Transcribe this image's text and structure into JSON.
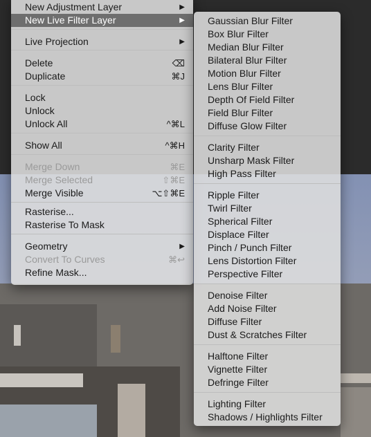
{
  "main_menu": {
    "items": [
      {
        "label": "New Adjustment Layer",
        "shortcut": "",
        "has_submenu": true
      },
      {
        "label": "New Live Filter Layer",
        "shortcut": "",
        "has_submenu": true
      },
      {
        "label": "Live Projection",
        "shortcut": "",
        "has_submenu": true
      },
      {
        "label": "Delete",
        "shortcut": "⌫"
      },
      {
        "label": "Duplicate",
        "shortcut": "⌘J"
      },
      {
        "label": "Lock",
        "shortcut": ""
      },
      {
        "label": "Unlock",
        "shortcut": ""
      },
      {
        "label": "Unlock All",
        "shortcut": "^⌘L"
      },
      {
        "label": "Show All",
        "shortcut": "^⌘H"
      },
      {
        "label": "Merge Down",
        "shortcut": "⌘E",
        "disabled": true
      },
      {
        "label": "Merge Selected",
        "shortcut": "⇧⌘E",
        "disabled": true
      },
      {
        "label": "Merge Visible",
        "shortcut": "⌥⇧⌘E"
      },
      {
        "label": "Rasterise...",
        "shortcut": ""
      },
      {
        "label": "Rasterise To Mask",
        "shortcut": ""
      },
      {
        "label": "Geometry",
        "shortcut": "",
        "has_submenu": true
      },
      {
        "label": "Convert To Curves",
        "shortcut": "⌘↩",
        "disabled": true
      },
      {
        "label": "Refine Mask...",
        "shortcut": ""
      }
    ],
    "highlighted": "New Live Filter Layer",
    "arrow_glyph": "▶"
  },
  "submenu": {
    "items": [
      "Gaussian Blur Filter",
      "Box Blur Filter",
      "Median Blur Filter",
      "Bilateral Blur Filter",
      "Motion Blur Filter",
      "Lens Blur Filter",
      "Depth Of Field Filter",
      "Field Blur Filter",
      "Diffuse Glow Filter",
      "Clarity Filter",
      "Unsharp Mask Filter",
      "High Pass Filter",
      "Ripple Filter",
      "Twirl Filter",
      "Spherical Filter",
      "Displace Filter",
      "Pinch / Punch Filter",
      "Lens Distortion Filter",
      "Perspective Filter",
      "Denoise Filter",
      "Add Noise Filter",
      "Diffuse Filter",
      "Dust & Scratches Filter",
      "Halftone Filter",
      "Vignette Filter",
      "Defringe Filter",
      "Lighting Filter",
      "Shadows / Highlights Filter"
    ]
  },
  "colors": {
    "menu_bg": "#dedede",
    "highlight": "#6e6e6e",
    "canvas_dark": "#2b2b2b",
    "sky": "#8a97b6"
  },
  "icons": {
    "submenu_arrow": "triangle-right-icon",
    "delete_shortcut": "backspace-icon"
  }
}
